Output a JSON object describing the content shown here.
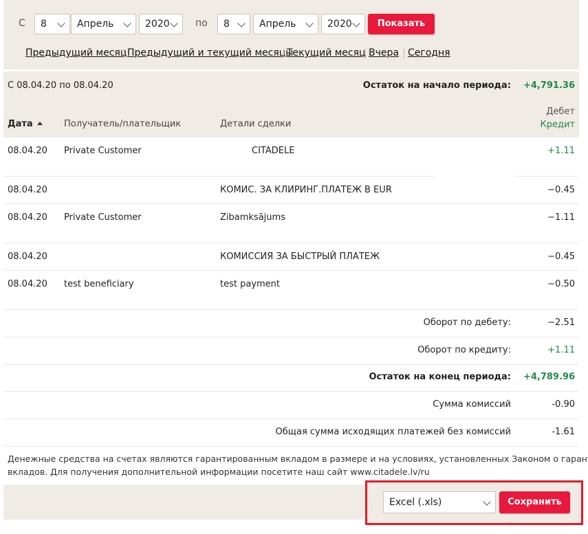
{
  "filter": {
    "from_label": "С",
    "from_day": "8",
    "from_month": "Апрель",
    "from_year": "2020",
    "to_label": "по",
    "to_day": "8",
    "to_month": "Апрель",
    "to_year": "2020",
    "show_button": "Показать"
  },
  "quick_links": [
    "Предыдущий месяц",
    "Предыдущий и текущий месяцы",
    "Текущий месяц",
    "Вчера",
    "Сегодня"
  ],
  "summary": {
    "period": "С 08.04.20 по 08.04.20",
    "opening_label": "Остаток на начало периода:",
    "opening_value": "+4,791.36"
  },
  "columns": {
    "date": "Дата",
    "counterparty": "Получатель/плательщик",
    "details": "Детали сделки",
    "debit": "Дебет",
    "credit": "Кредит"
  },
  "rows": [
    {
      "date": "08.04.20",
      "counterparty": "Private Customer",
      "details": "CITADELE",
      "amount": "+1.11"
    },
    {
      "date": "08.04.20",
      "counterparty": "",
      "details": "КОМИС. ЗА КЛИРИНГ.ПЛАТЕЖ В EUR",
      "amount": "−0.45"
    },
    {
      "date": "08.04.20",
      "counterparty": "Private Customer",
      "details": "Zibamksājums",
      "amount": "−1.11"
    },
    {
      "date": "08.04.20",
      "counterparty": "",
      "details": "КОМИССИЯ ЗА БЫСТРЫЙ ПЛАТЕЖ",
      "amount": "−0.45"
    },
    {
      "date": "08.04.20",
      "counterparty": "test beneficiary",
      "details": "test payment",
      "amount": "−0.50"
    }
  ],
  "totals": [
    {
      "label": "Оборот по дебету:",
      "value": "−2.51"
    },
    {
      "label": "Оборот по кредиту:",
      "value": "+1.11"
    },
    {
      "label": "Остаток на конец периода:",
      "value": "+4,789.96"
    },
    {
      "label": "Сумма комиссий",
      "value": "-0.90"
    },
    {
      "label": "Общая сумма исходящих платежей без комиссий",
      "value": "-1.61"
    }
  ],
  "disclaimer_line1": "Денежные средства на счетах являются гарантированным вкладом в размере и на условиях, установленных Законом о гарантии",
  "disclaimer_line2": "вкладов. Для получения дополнительной информации посетите наш сайт www.citadele.lv/ru",
  "export": {
    "format": "Excel (.xls)",
    "save_button": "Сохранить"
  },
  "colors": {
    "accent": "#e8193c",
    "positive": "#1f8a4c",
    "panel": "#f0ebe4"
  }
}
